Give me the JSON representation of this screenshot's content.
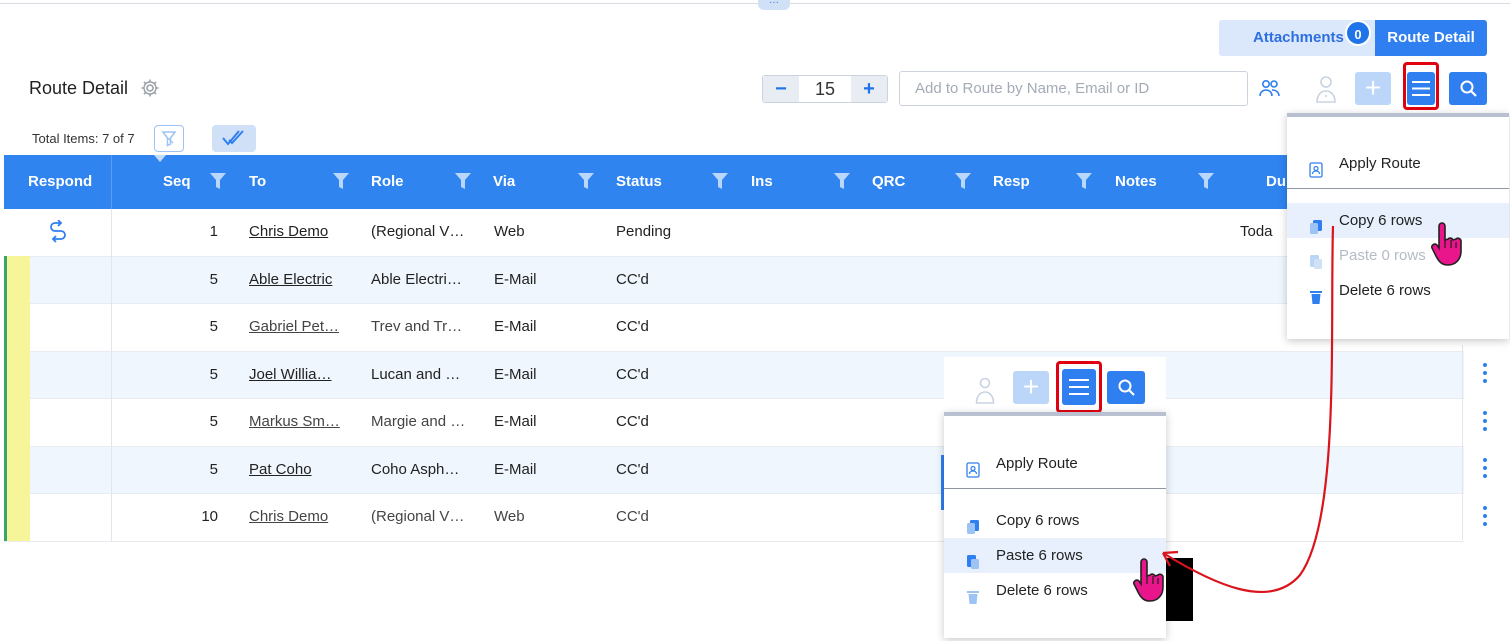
{
  "header": {
    "drag_handle_glyph": "···",
    "attachments_label": "Attachments",
    "attachments_count": "0",
    "route_detail_button": "Route Detail"
  },
  "toolbar": {
    "title": "Route Detail",
    "stepper_value": "15",
    "stepper_minus": "−",
    "stepper_plus": "+",
    "add_placeholder": "Add to Route by Name, Email or ID",
    "plus_glyph": "+"
  },
  "summary": {
    "total_items": "Total Items: 7 of 7"
  },
  "grid": {
    "columns": [
      "Respond",
      "Seq",
      "To",
      "Role",
      "Via",
      "Status",
      "Ins",
      "QRC",
      "Resp",
      "Notes",
      "Du"
    ],
    "rows": [
      {
        "seq": "1",
        "to": "Chris Demo",
        "role": "(Regional V…",
        "via": "Web",
        "status": "Pending",
        "due": "Toda"
      },
      {
        "seq": "5",
        "to": "Able Electric",
        "role": "Able Electri…",
        "via": "E-Mail",
        "status": "CC'd",
        "due": ""
      },
      {
        "seq": "5",
        "to": "Gabriel Pet…",
        "role": "Trev and Tr…",
        "via": "E-Mail",
        "status": "CC'd",
        "due": ""
      },
      {
        "seq": "5",
        "to": "Joel Willia…",
        "role": "Lucan and …",
        "via": "E-Mail",
        "status": "CC'd",
        "due": ""
      },
      {
        "seq": "5",
        "to": "Markus Sm…",
        "role": "Margie and …",
        "via": "E-Mail",
        "status": "CC'd",
        "due": ""
      },
      {
        "seq": "5",
        "to": "Pat Coho",
        "role": "Coho Asph…",
        "via": "E-Mail",
        "status": "CC'd",
        "due": ""
      },
      {
        "seq": "10",
        "to": "Chris Demo",
        "role": "(Regional V…",
        "via": "Web",
        "status": "CC'd",
        "due": ""
      }
    ]
  },
  "menu_top": {
    "apply_route": "Apply Route",
    "copy": "Copy 6 rows",
    "paste": "Paste 0 rows",
    "delete": "Delete 6 rows"
  },
  "menu_inset": {
    "apply_route": "Apply Route",
    "copy": "Copy 6 rows",
    "paste": "Paste 6 rows",
    "delete": "Delete 6 rows",
    "plus_glyph": "+"
  },
  "colors": {
    "primary": "#2f7ff0",
    "header_bg": "#2f84f0",
    "highlight_red": "#e00010",
    "cursor_magenta": "#e8168a"
  }
}
